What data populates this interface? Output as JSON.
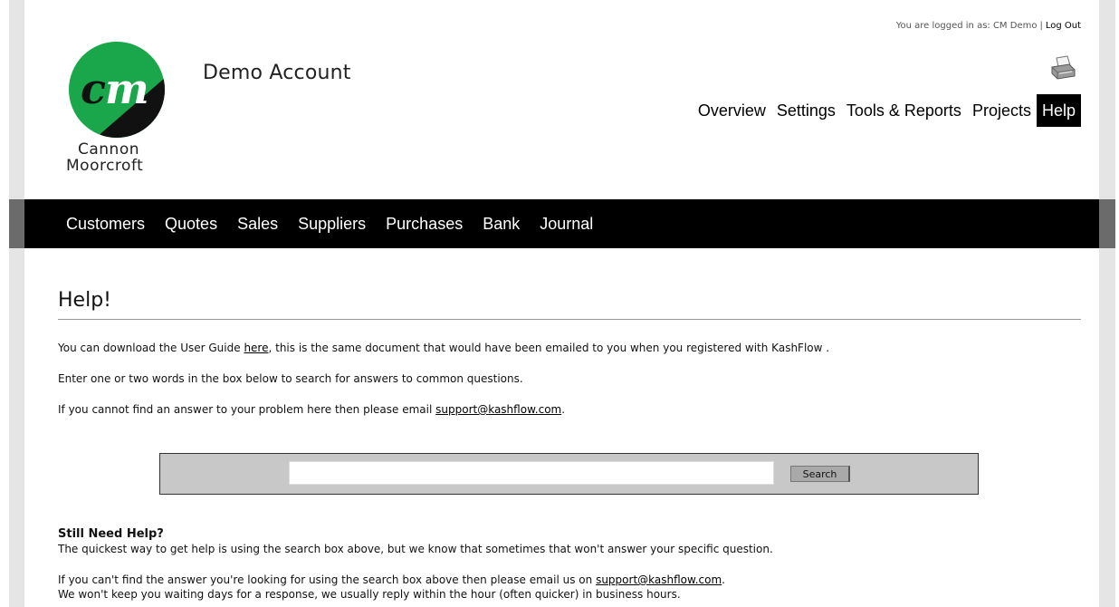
{
  "header": {
    "login_prefix": "You are logged in as: CM Demo",
    "logout_label": "Log Out",
    "account_title": "Demo Account",
    "brand_line1": "Cannon",
    "brand_line2": "Moorcroft",
    "logo_initials": "CM",
    "print_icon": "printer-icon"
  },
  "top_nav": [
    {
      "label": "Overview",
      "active": false
    },
    {
      "label": "Settings",
      "active": false
    },
    {
      "label": "Tools & Reports",
      "active": false
    },
    {
      "label": "Projects",
      "active": false
    },
    {
      "label": "Help",
      "active": true
    }
  ],
  "main_nav": [
    {
      "label": "Customers"
    },
    {
      "label": "Quotes"
    },
    {
      "label": "Sales"
    },
    {
      "label": "Suppliers"
    },
    {
      "label": "Purchases"
    },
    {
      "label": "Bank"
    },
    {
      "label": "Journal"
    }
  ],
  "content": {
    "heading": "Help!",
    "p1_before": "You can download the User Guide ",
    "p1_link": "here",
    "p1_after": ", this is the same document that would have been emailed to you when you registered with KashFlow .",
    "p2": "Enter one or two words in the box below to search for answers to common questions.",
    "p3_before": "If you cannot find an answer to your problem here then please email ",
    "p3_link": "support@kashflow.com",
    "p3_after": ".",
    "search_value": "",
    "search_button": "Search",
    "still_heading": "Still Need Help?",
    "p4": "The quickest way to get help is using the search box above, but we know that sometimes that won't answer your specific question.",
    "p5_before": "If you can't find the answer you're looking for using the search box above then please email us on ",
    "p5_link": "support@kashflow.com",
    "p5_after": ".",
    "p6": "We won't keep you waiting days for a response, we usually reply within the hour (often quicker) in business hours."
  },
  "colors": {
    "logo_green": "#1aa64a",
    "logo_dark": "#111111",
    "menu_bar": "#000000",
    "search_panel": "#c8c8c8"
  }
}
